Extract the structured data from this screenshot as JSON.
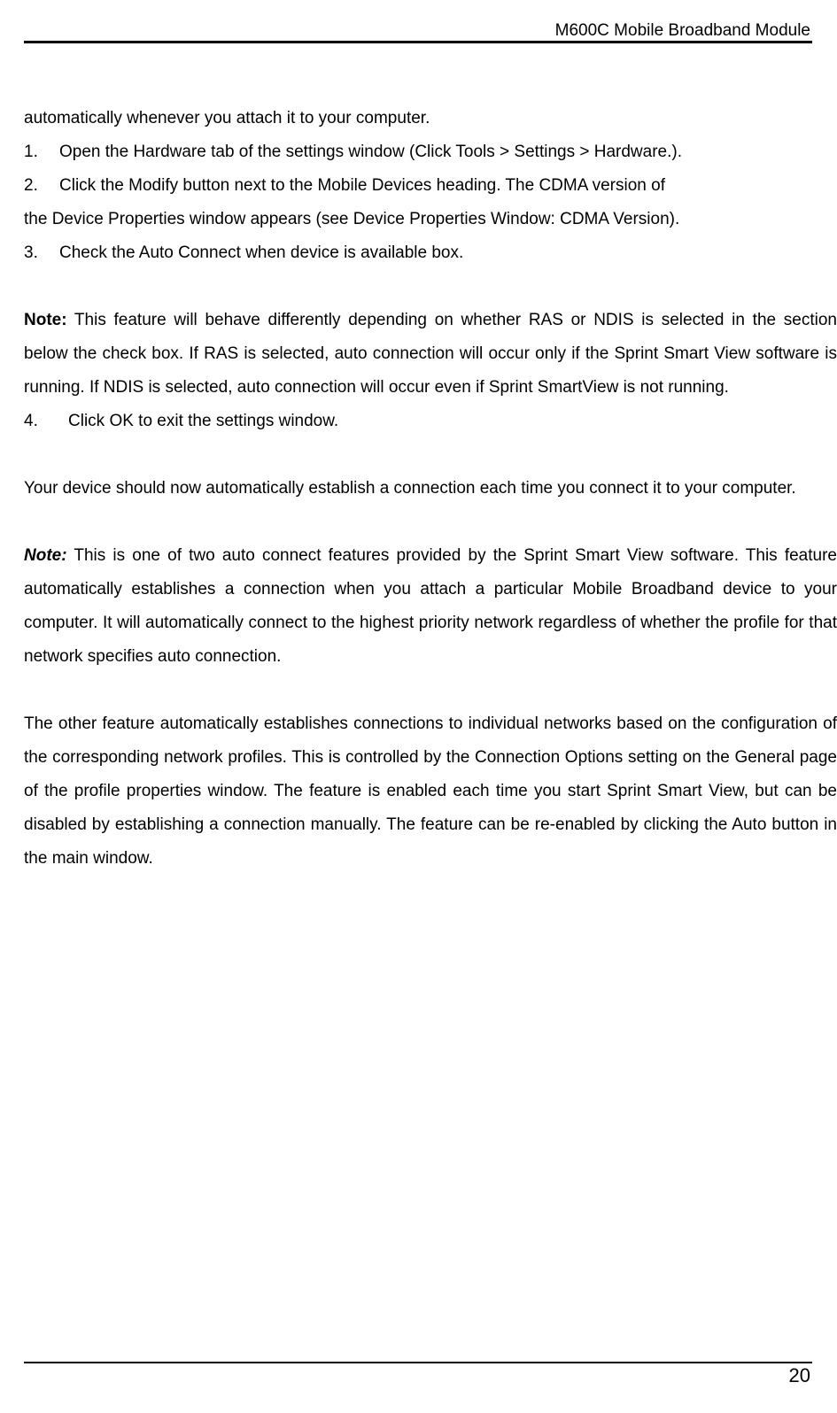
{
  "header": {
    "title": "M600C Mobile Broadband Module"
  },
  "body": {
    "p0": "automatically whenever you attach it to your computer.",
    "list1": {
      "num": "1.",
      "text": "Open the Hardware tab of the settings window (Click Tools > Settings > Hardware.)."
    },
    "list2": {
      "num": "2.",
      "text_a": "Click the Modify button next to the Mobile Devices heading. The CDMA version of",
      "text_b": "the Device Properties window appears (see Device Properties Window: CDMA Version)."
    },
    "list3": {
      "num": "3.",
      "text": "Check the Auto Connect when device is available box."
    },
    "note1": {
      "label": "Note:",
      "text": " This feature will behave differently depending on whether RAS or NDIS is selected in the section below the check box. If RAS is selected, auto connection will occur only if the Sprint Smart View software is running. If NDIS is selected, auto connection will occur even if Sprint SmartView is not running."
    },
    "list4": {
      "num": "4.",
      "text": "Click OK to exit the settings window."
    },
    "p1": "Your device should now automatically establish a connection each time you connect it to your computer.",
    "note2": {
      "label": "Note:",
      "text": " This is one of two auto connect features provided by the Sprint Smart View software. This feature automatically establishes a connection when you attach a particular Mobile Broadband device to your computer. It will automatically connect to the highest priority network regardless of whether the profile for that network specifies auto connection."
    },
    "p2": "The other feature automatically establishes connections to individual networks based on the configuration of the corresponding network profiles. This is controlled by the Connection Options setting on the General page of the profile properties window. The feature is enabled each time you start Sprint Smart View, but can be disabled by establishing a connection manually. The feature can be re-enabled by clicking the Auto button in the main window."
  },
  "footer": {
    "page_number": "20"
  }
}
